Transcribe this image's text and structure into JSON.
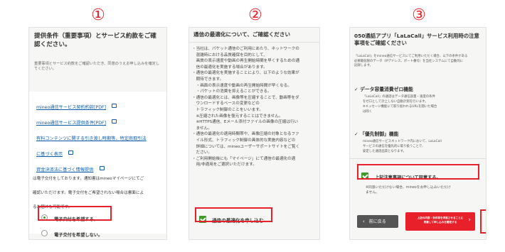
{
  "steps": [
    "①",
    "②",
    "③"
  ],
  "panel1": {
    "title": "提供条件（重要事項）とサービス約款をご確認ください。",
    "desc": "重要事項とサービス約款をご確認いただき、同意のうえお申し込みを確定してください。",
    "links": [
      "mineo通信サービス契約約款[PDF]",
      "mineo通信サービス提供条件[PDF]",
      "有料コンテンツに関する引き渡し時期等、特定商取引法",
      "に基づく表示",
      "資金決済法に基づく情報提供"
    ],
    "notice_lines": [
      "は電子交付をしております。通知書はmineoマイページにてご",
      "確認いただけます。電子交付をご希望されない場合は書面によ",
      "るお届けも可能です。"
    ],
    "options": [
      "電子交付を希望する。",
      "電子交付を希望しない。"
    ]
  },
  "panel2": {
    "title": "通信の最適化について、ご確認ください",
    "lines": [
      "・当社は、パケット通信のご利用にあたり、ネットワークの",
      "　混雑時における品質確保を目的として、",
      "　画質の表示速度や動画の再生開始時間を早くするための通",
      "　信の最適化を実施する場合があります。",
      "・通信の最適化を実施することにより、以下のような効果が",
      "　期待できます。",
      "　・画面の表示速度や動画の再生開始時間が早くなる。",
      "　・パケットの消費を抑えることができる。",
      "・通信の最適化とは、画像等を圧縮することで、動画等をダ",
      "　ウンロードするベースの変更などの",
      "　トラフィック制御のことをいいます。",
      "　※圧縮された画像を復元することはできません。",
      "　※HTTPS通信、Eメール添付ファイルの画像の圧縮は行い",
      "　ません。",
      "・通信の最適化の適用時間帯や、画像圧縮の対象となるファ",
      "　イル形式、トラフィック制御の具体的な実施内容などの",
      "　詳細については、mineoユーザーサポートサイトをご覧く",
      "　ださい。",
      "・ご利用開始後にも「マイページ」にて通信の最適化の適",
      "　用/非適用をご選択いただけます。"
    ],
    "agree_label": "通信の最適化を申し込む"
  },
  "panel3": {
    "title": "050通話アプリ「LaLaCall」サービス利用時の注意事項をご確認ください",
    "intro": [
      "「LaLaCall」をmineo通信サービスにてご利用いただく場合、以下の条件がある",
      "必要最低限のデータ（IPアドレス、ポート番号）を当社システムにて自動的に",
      "記録します。"
    ],
    "sections": [
      {
        "heading": "データ容量消費ゼロ機能",
        "body": [
          "「LaLaCall」の通話はデータ通信容量・速度の条件",
          "をゼロとして計上しない自動計測を行います。",
          "※メッセージ機能にて取り扱われるURLを開いた場合",
          "は除く"
        ]
      },
      {
        "heading": "「優先制御」機能",
        "body": [
          "mineo通信サービスネットワーク内において、LaLaCall",
          "サービスの通信を優先的に取り扱うことで、",
          "安定した通話品質となります。"
        ]
      }
    ],
    "agree_label": "上記注意事項について同意する。",
    "note": [
      "※同意いただけない場合、mineoをお申し込みいただけ",
      "ません。"
    ],
    "back_label": "前に戻る",
    "next_label": [
      "上記の内容・条件等を同意させることに",
      "同意して申し込みを確定する"
    ]
  }
}
